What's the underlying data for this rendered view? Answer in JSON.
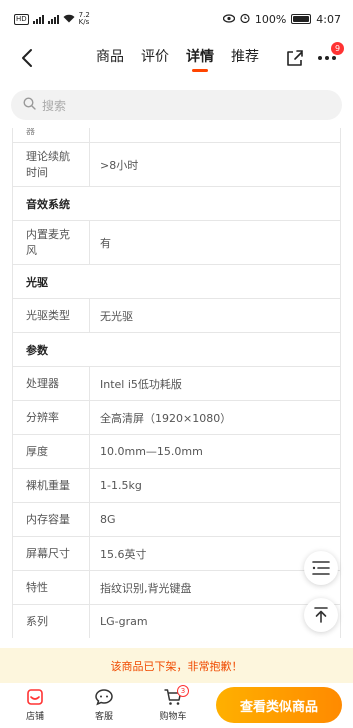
{
  "status_bar": {
    "network": "HD",
    "sig1": "4G",
    "sig2": "4G",
    "speed": "7.2\nK/s",
    "battery": "100%",
    "time": "4:07"
  },
  "header": {
    "tabs": [
      "商品",
      "评价",
      "详情",
      "推荐"
    ],
    "active_tab": "详情",
    "more_badge": "9"
  },
  "search": {
    "placeholder": "搜索"
  },
  "spec": {
    "partial_top": "器",
    "rows": [
      {
        "type": "kv",
        "key": "理论续航时间",
        "value": ">8小时"
      },
      {
        "type": "section",
        "title": "音效系统"
      },
      {
        "type": "kv",
        "key": "内置麦克风",
        "value": "有"
      },
      {
        "type": "section",
        "title": "光驱"
      },
      {
        "type": "kv",
        "key": "光驱类型",
        "value": "无光驱"
      },
      {
        "type": "section",
        "title": "参数"
      },
      {
        "type": "kv",
        "key": "处理器",
        "value": "Intel i5低功耗版"
      },
      {
        "type": "kv",
        "key": "分辨率",
        "value": "全高清屏（1920×1080）"
      },
      {
        "type": "kv",
        "key": "厚度",
        "value": "10.0mm—15.0mm"
      },
      {
        "type": "kv",
        "key": "裸机重量",
        "value": "1-1.5kg"
      },
      {
        "type": "kv",
        "key": "内存容量",
        "value": "8G"
      },
      {
        "type": "kv",
        "key": "屏幕尺寸",
        "value": "15.6英寸"
      },
      {
        "type": "kv",
        "key": "特性",
        "value": "指纹识别,背光键盘"
      },
      {
        "type": "kv",
        "key": "系列",
        "value": "LG-gram"
      }
    ]
  },
  "notice": "该商品已下架，非常抱歉！",
  "bottom": {
    "store": "店铺",
    "service": "客服",
    "cart": "购物车",
    "cart_badge": "3",
    "cta": "查看类似商品"
  },
  "colors": {
    "accent": "#ff4400",
    "cta_start": "#ffb000",
    "cta_end": "#ff8a00",
    "notice_bg": "#fdf6dd",
    "notice_text": "#f04a00"
  }
}
